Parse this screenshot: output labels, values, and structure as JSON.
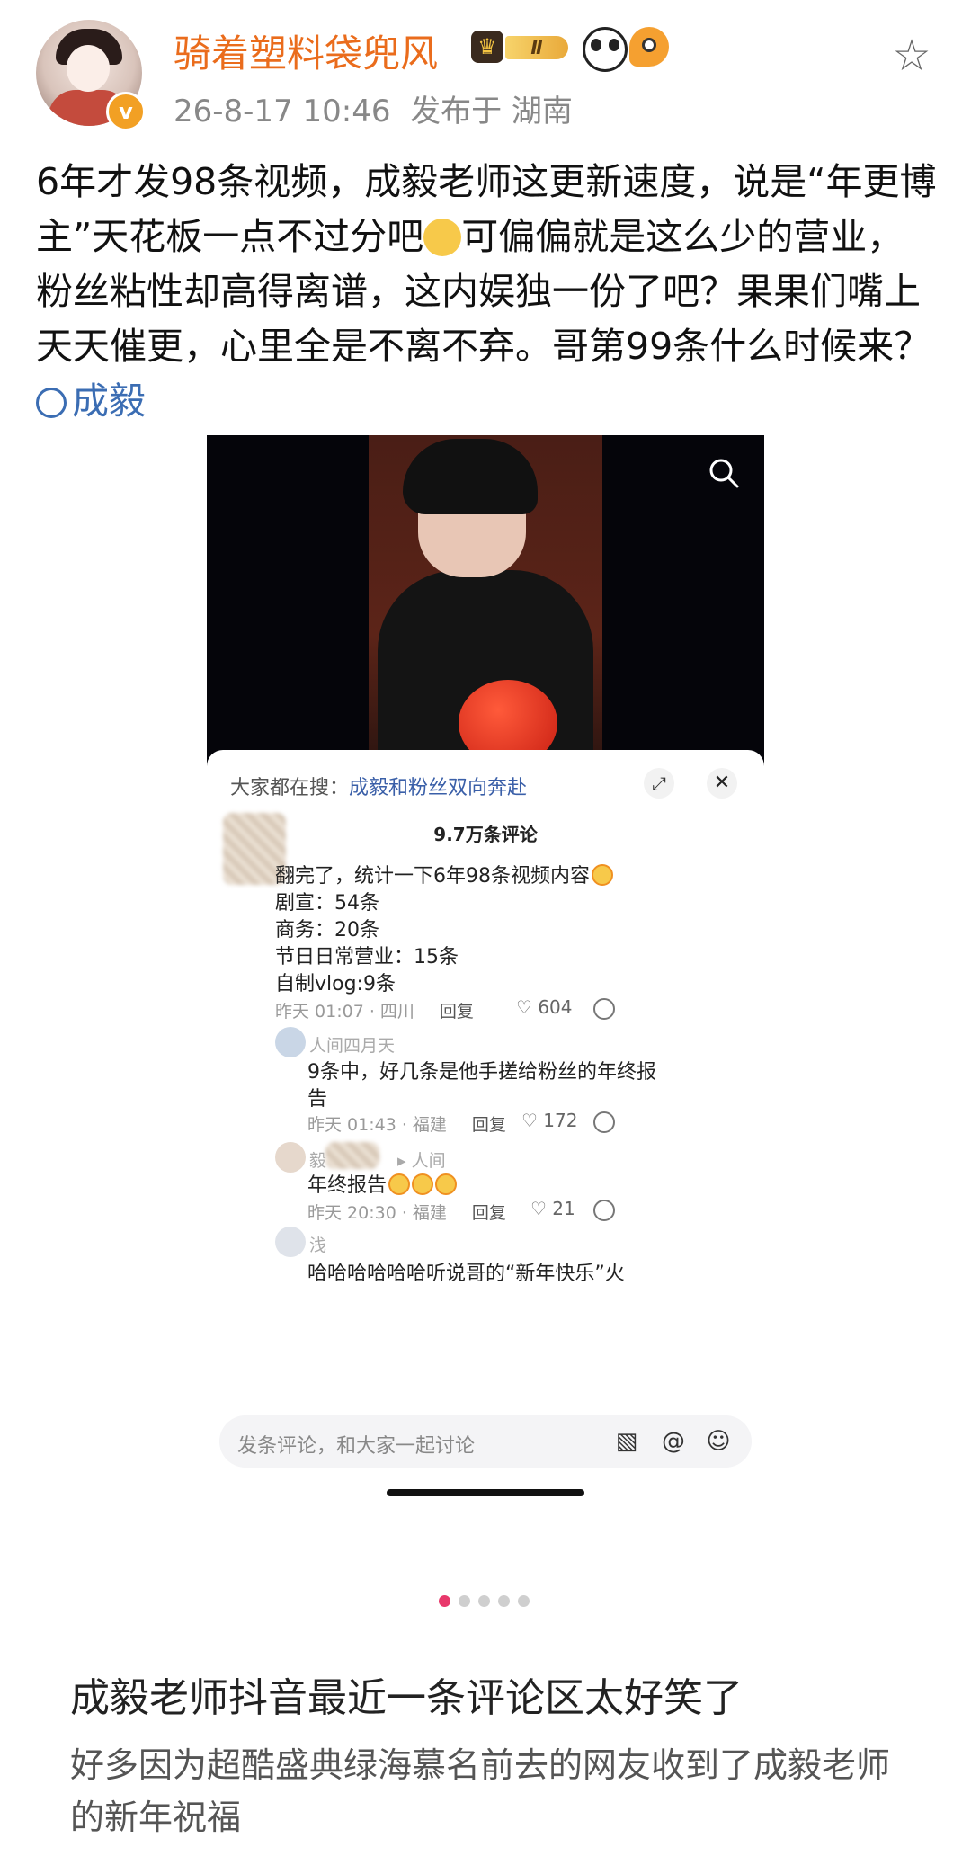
{
  "header": {
    "username": "骑着塑料袋兜风",
    "level_label": "Ⅱ",
    "verified_mark": "v",
    "timestamp": "26-8-17 10:46",
    "location": "发布于 湖南",
    "icons": [
      "crown-icon",
      "panda-emoji-icon",
      "fish-emoji-icon",
      "star-favorite-icon"
    ]
  },
  "post": {
    "text_part1": "6年才发98条视频，成毅老师这更新速度，说是“年更博主”天花板一点不过分吧",
    "text_part2": "可偏偏就是这么少的营业，粉丝粘性却高得离谱，这内娱独一份了吧？果果们嘴上天天催更，心里全是不离不弃。哥第99条什么时候来？",
    "topic": "成毅"
  },
  "embedded": {
    "search_prefix": "大家都在搜：",
    "search_keyword": "成毅和粉丝双向奔赴",
    "comment_count": "9.7万条评论",
    "expand_icon": "⤢",
    "close_icon": "✕",
    "comments": [
      {
        "lines": [
          "翻完了，统计一下6年98条视频内容",
          "剧宣：54条",
          "商务：20条",
          "节日日常营业：15条",
          "自制vlog:9条"
        ],
        "meta": "昨天 01:07 · 四川",
        "reply": "回复",
        "likes": "604"
      },
      {
        "user": "人间四月天",
        "lines": [
          "9条中，好几条是他手搓给粉丝的年终报",
          "告"
        ],
        "meta": "昨天 01:43 · 福建",
        "reply": "回复",
        "likes": "172"
      },
      {
        "user": "毅",
        "reply_to": "▸ 人间",
        "lines": [
          "年终报告"
        ],
        "meta": "昨天 20:30 · 福建",
        "reply": "回复",
        "likes": "21"
      },
      {
        "user": "浅",
        "lines": [
          "哈哈哈哈哈哈听说哥的“新年快乐”火"
        ]
      }
    ],
    "input_placeholder": "发条评论，和大家一起讨论"
  },
  "carousel": {
    "total": 5,
    "active": 1
  },
  "caption": {
    "title": "成毅老师抖音最近一条评论区太好笑了",
    "desc": "好多因为超酷盛典绿海慕名前去的网友收到了成毅老师的新年祝福"
  },
  "colors": {
    "username": "#ea6c1c",
    "topic": "#3b6db3",
    "active_dot": "#e8386b"
  }
}
